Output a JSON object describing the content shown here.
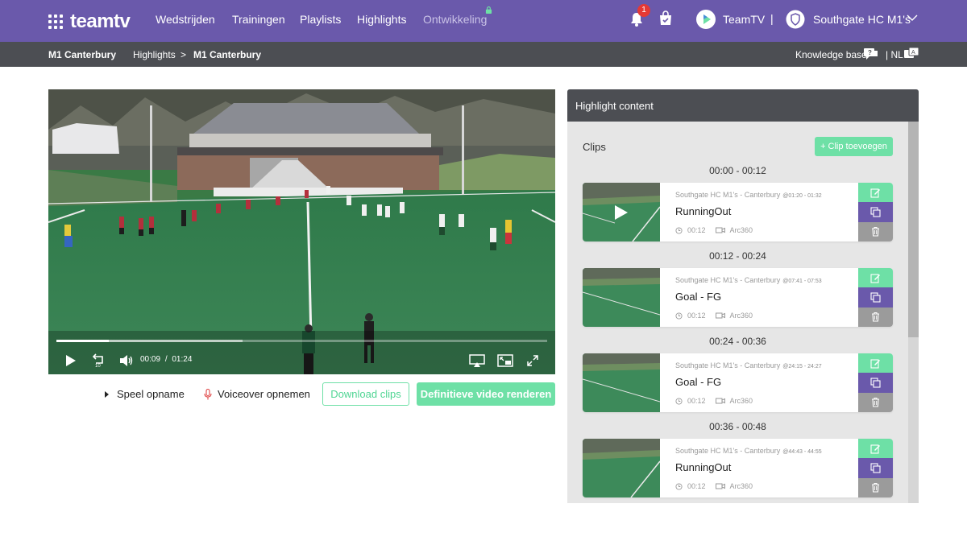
{
  "app": {
    "logo": "teamtv"
  },
  "nav": {
    "items": [
      "Wedstrijden",
      "Trainingen",
      "Playlists",
      "Highlights"
    ],
    "locked_item": "Ontwikkeling",
    "notification_count": "1",
    "user": "TeamTV",
    "separator": "|",
    "team": "Southgate HC M1's"
  },
  "breadcrumb": {
    "context": "M1 Canterbury",
    "section": "Highlights",
    "arrow": ">",
    "current": "M1 Canterbury",
    "help": "Knowledge base",
    "language": "| NL"
  },
  "player": {
    "current_time": "00:09",
    "divider": "/",
    "duration": "01:24",
    "progress": 0.107,
    "buffered": 0.38
  },
  "actions": {
    "play_recording": "Speel opname",
    "voiceover": "Voiceover opnemen",
    "download": "Download clips",
    "render": "Definitieve video renderen"
  },
  "panel": {
    "title": "Highlight content",
    "clips_label": "Clips",
    "add_clip": "+ Clip toevoegen",
    "clips": [
      {
        "range": "00:00 - 00:12",
        "source": "Southgate HC M1's - Canterbury",
        "at": "@01:20 - 01:32",
        "title": "RunningOut",
        "duration": "00:12",
        "camera": "Arc360"
      },
      {
        "range": "00:12 - 00:24",
        "source": "Southgate HC M1's - Canterbury",
        "at": "@07:41 - 07:53",
        "title": "Goal - FG",
        "duration": "00:12",
        "camera": "Arc360"
      },
      {
        "range": "00:24 - 00:36",
        "source": "Southgate HC M1's - Canterbury",
        "at": "@24:15 - 24:27",
        "title": "Goal - FG",
        "duration": "00:12",
        "camera": "Arc360"
      },
      {
        "range": "00:36 - 00:48",
        "source": "Southgate HC M1's - Canterbury",
        "at": "@44:43 - 44:55",
        "title": "RunningOut",
        "duration": "00:12",
        "camera": "Arc360"
      }
    ]
  },
  "colors": {
    "brand": "#6a59ab",
    "accent": "#6ee0a6",
    "bar": "#4c4e53"
  }
}
